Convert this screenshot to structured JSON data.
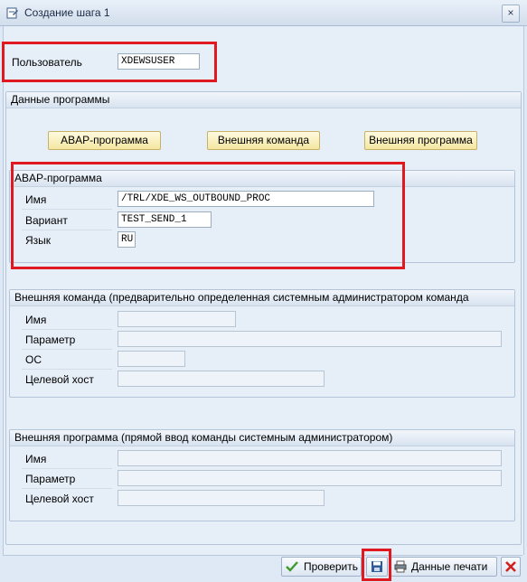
{
  "window": {
    "title": "Создание шага  1",
    "close_glyph": "×"
  },
  "user": {
    "label": "Пользователь",
    "value": "XDEWSUSER"
  },
  "program_data": {
    "header": "Данные программы",
    "buttons": {
      "abap": "ABAP-программа",
      "ext_command": "Внешняя команда",
      "ext_program": "Внешняя программа"
    }
  },
  "abap_group": {
    "header": "ABAP-программа",
    "name_label": "Имя",
    "name_value": "/TRL/XDE_WS_OUTBOUND_PROC",
    "variant_label": "Вариант",
    "variant_value": "TEST_SEND_1",
    "lang_label": "Язык",
    "lang_value": "RU"
  },
  "ext_command_group": {
    "header": "Внешняя команда (предварительно определенная системным администратором команда",
    "name_label": "Имя",
    "param_label": "Параметр",
    "os_label": "ОС",
    "host_label": "Целевой хост"
  },
  "ext_program_group": {
    "header": "Внешняя программа (прямой ввод команды системным администратором)",
    "name_label": "Имя",
    "param_label": "Параметр",
    "host_label": "Целевой хост"
  },
  "footer": {
    "check": "Проверить",
    "print_data": "Данные печати"
  },
  "icons": {
    "title": "window-edit-icon",
    "check": "green-check-icon",
    "save": "save-disk-icon",
    "print": "printer-icon",
    "cancel": "red-x-icon"
  },
  "colors": {
    "highlight": "#e0181f",
    "accent_button": "#f4e6a0"
  }
}
